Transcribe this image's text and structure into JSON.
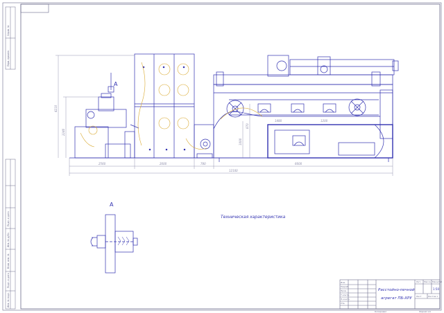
{
  "sheet": {
    "top_left_stamp": "",
    "view_label_main": "А",
    "view_label_section": "А",
    "note_title": "Техническая характеристика"
  },
  "dimensions": {
    "height_overall": "4210",
    "height_lower": "2240",
    "len_1": "2560",
    "len_2": "2000",
    "len_3": "780",
    "len_4": "6600",
    "len_total": "12100",
    "inner_1": "1480",
    "inner_2": "1200",
    "inner_3": "870",
    "inner_4": "1000"
  },
  "side_stamp": {
    "c1": "Инв. № подл.",
    "c2": "Подп. и дата",
    "c3": "Взам. инв. №",
    "c4": "Инв. № дубл.",
    "c5": "Подп. и дата",
    "c6": "Перв. примен.",
    "c7": "Справ. №"
  },
  "title_block": {
    "name_line1": "Расстойно-печной",
    "name_line2": "агрегат ПБ-ХРУ",
    "scale": "1:50",
    "mass": "",
    "sheet": "Лист",
    "sheets": "Листов 1",
    "copied": "Копировал",
    "format": "Формат A1",
    "row_labels": [
      "Изм.",
      "Разраб.",
      "Пров.",
      "Т.контр.",
      "Н.контр.",
      "Утв."
    ],
    "col_labels": [
      "Лит.",
      "Масса",
      "Масштаб"
    ]
  },
  "colors": {
    "line": "#3030b0",
    "dim": "#8a8aa8",
    "accent": "#d9a930",
    "frame": "#6a6a8a"
  }
}
